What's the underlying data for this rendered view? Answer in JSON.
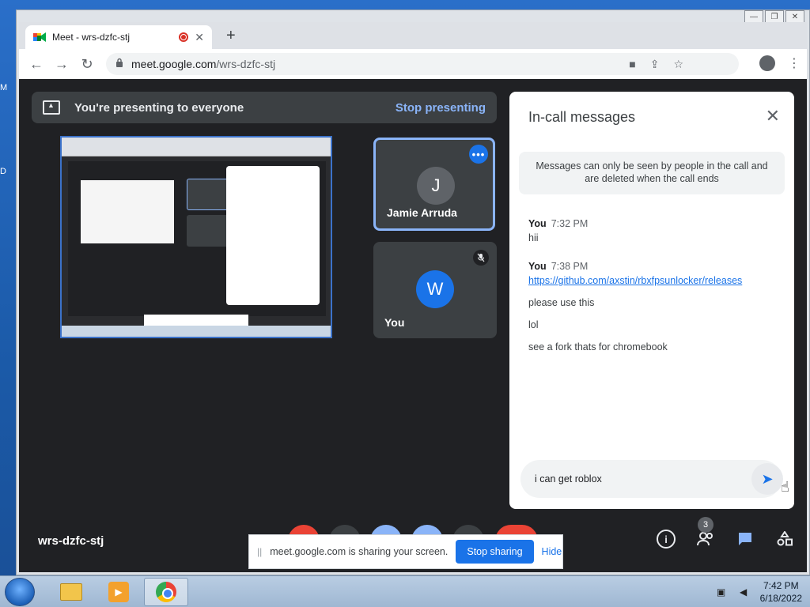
{
  "browser": {
    "tab_title": "Meet - wrs-dzfc-stj",
    "url_host": "meet.google.com",
    "url_path": "/wrs-dzfc-stj"
  },
  "meet": {
    "presenting_text": "You're presenting to everyone",
    "stop_presenting": "Stop presenting",
    "meeting_code": "wrs-dzfc-stj",
    "participants_count": "3",
    "tiles": [
      {
        "initial": "J",
        "name": "Jamie Arruda"
      },
      {
        "initial": "W",
        "name": "You"
      }
    ]
  },
  "chat": {
    "title": "In-call messages",
    "notice": "Messages can only be seen by people in the call and are deleted when the call ends",
    "groups": [
      {
        "sender": "You",
        "time": "7:32 PM",
        "lines": [
          "hii"
        ]
      },
      {
        "sender": "You",
        "time": "7:38 PM",
        "link": "https://github.com/axstin/rbxfpsunlocker/releases",
        "lines": [
          "please use this",
          "lol",
          "see a fork thats for chromebook"
        ]
      }
    ],
    "composer_value": "i can get roblox"
  },
  "share_banner": {
    "text": "meet.google.com is sharing your screen.",
    "stop_sharing": "Stop sharing",
    "hide": "Hide"
  },
  "taskbar": {
    "time": "7:42 PM",
    "date": "6/18/2022"
  },
  "desktop": {
    "edge_letters": [
      "M",
      "D"
    ]
  },
  "colors": {
    "meet_bg": "#202124",
    "accent_blue": "#1a73e8",
    "link_blue": "#8ab4f8"
  }
}
